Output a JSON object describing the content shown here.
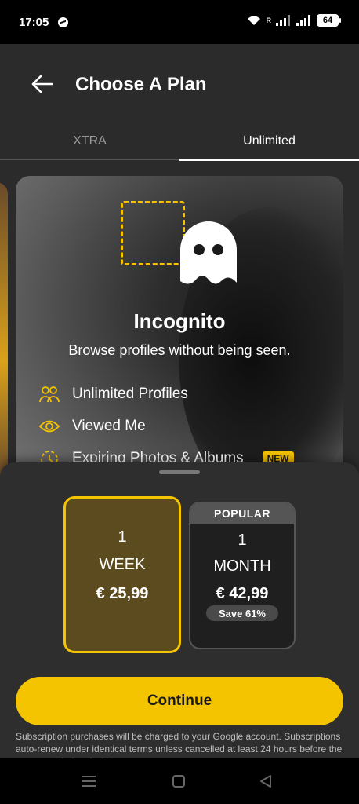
{
  "status_bar": {
    "time": "17:05",
    "battery": "64",
    "icons": [
      "messenger-icon",
      "wifi-icon",
      "signal-icon",
      "battery-icon"
    ]
  },
  "header": {
    "title": "Choose A Plan",
    "back_icon": "arrow-left-icon"
  },
  "tabs": [
    {
      "label": "XTRA",
      "selected": false
    },
    {
      "label": "Unlimited",
      "selected": true
    }
  ],
  "plan_card": {
    "title": "Incognito",
    "subtitle": "Browse profiles without being seen.",
    "features": [
      {
        "icon": "people-icon",
        "label": "Unlimited Profiles"
      },
      {
        "icon": "eye-icon",
        "label": "Viewed Me"
      },
      {
        "icon": "timer-icon",
        "label": "Expiring Photos & Albums",
        "badge": "NEW"
      }
    ]
  },
  "options": [
    {
      "count": "1",
      "unit": "WEEK",
      "price": "€ 25,99",
      "selected": true
    },
    {
      "banner": "POPULAR",
      "count": "1",
      "unit": "MONTH",
      "price": "€ 42,99",
      "save": "Save 61%",
      "selected": false
    }
  ],
  "continue_label": "Continue",
  "disclaimer": "Subscription purchases will be charged to your Google account. Subscriptions auto-renew under identical terms unless cancelled at least 24 hours before the current period ends. You can manage",
  "colors": {
    "accent": "#f5c400",
    "background": "#2b2b2b",
    "selected_option_bg": "#5b4b1e"
  }
}
